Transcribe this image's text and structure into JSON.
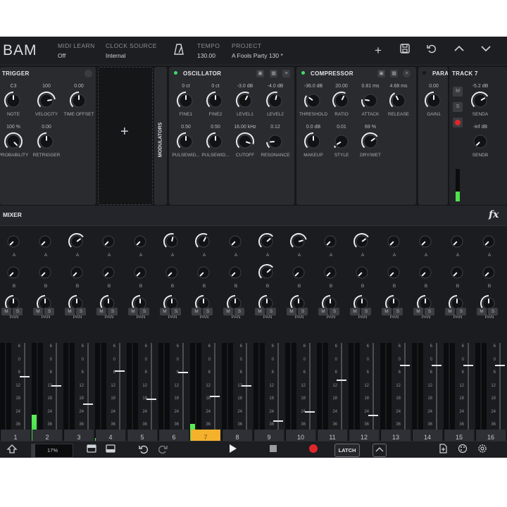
{
  "topbar": {
    "logo": "BAM",
    "midi_learn": {
      "caption": "MIDI LEARN",
      "value": "Off"
    },
    "clock_source": {
      "caption": "CLOCK SOURCE",
      "value": "Internal"
    },
    "tempo": {
      "caption": "TEMPO",
      "value": "130.00"
    },
    "project": {
      "caption": "PROJECT",
      "value": "A Fools Party 130 *"
    },
    "icons": [
      "metronome-icon",
      "add-icon",
      "save-icon",
      "undo-icon",
      "chevron-up-icon",
      "chevron-down-icon"
    ]
  },
  "trigger": {
    "title": "TRIGGER",
    "knobs": [
      {
        "value": "C3",
        "label": "NOTE"
      },
      {
        "value": "100",
        "label": "VELOCITY"
      },
      {
        "value": "0.00",
        "label": "TIME OFFSET"
      },
      {
        "value": "100 %",
        "label": "PROBABILITY"
      },
      {
        "value": "0.00",
        "label": "RETRIGGER"
      }
    ]
  },
  "modulators": {
    "label": "MODULATORS",
    "add": "+"
  },
  "oscillator": {
    "title": "OSCILLATOR",
    "knobs": [
      {
        "value": "0 ct",
        "label": "FINE1"
      },
      {
        "value": "0 ct",
        "label": "FINE2"
      },
      {
        "value": "-3.0 dB",
        "label": "LEVEL1"
      },
      {
        "value": "-4.0 dB",
        "label": "LEVEL2"
      },
      {
        "value": "0.50",
        "label": "PULSEWID..."
      },
      {
        "value": "0.50",
        "label": "PULSEWID..."
      },
      {
        "value": "16.00 kHz",
        "label": "CUTOFF"
      },
      {
        "value": "0.12",
        "label": "RESONANCE"
      }
    ]
  },
  "compressor": {
    "title": "COMPRESSOR",
    "knobs": [
      {
        "value": "-36.0 dB",
        "label": "THRESHOLD"
      },
      {
        "value": "20.00",
        "label": "RATIO"
      },
      {
        "value": "0.81 ms",
        "label": "ATTACK"
      },
      {
        "value": "4.68 ms",
        "label": "RELEASE"
      },
      {
        "value": "0.0 dB",
        "label": "MAKEUP"
      },
      {
        "value": "0.01",
        "label": "STYLE"
      },
      {
        "value": "69 %",
        "label": "DRY/WET"
      }
    ]
  },
  "para": {
    "title": "PARA",
    "knob": {
      "value": "0.00",
      "label": "GAIN1"
    }
  },
  "track7": {
    "title": "TRACK 7",
    "buttons": [
      "M",
      "S"
    ],
    "knobs": [
      {
        "value": "-5.2 dB",
        "label": "SENDA"
      },
      {
        "value": "-inf dB",
        "label": "SENDB"
      }
    ]
  },
  "mixer": {
    "title": "MIXER",
    "fx_label": "fx",
    "row_labels": [
      "A",
      "B",
      "PAN"
    ],
    "mute_label": "M",
    "solo_label": "S",
    "scale": [
      "6",
      "0",
      "6",
      "12",
      "18",
      "24",
      "36",
      "48",
      "60"
    ],
    "tracks": [
      {
        "num": "1",
        "a": 0.0,
        "b": 0.0,
        "pan": 0.5,
        "fader": 0.7,
        "meter": 0.0
      },
      {
        "num": "2",
        "a": 0.0,
        "b": 0.0,
        "pan": 0.5,
        "fader": 0.62,
        "meter": 0.35
      },
      {
        "num": "3",
        "a": 0.7,
        "b": 0.0,
        "pan": 0.5,
        "fader": 0.45,
        "meter": 0.0
      },
      {
        "num": "4",
        "a": 0.0,
        "b": 0.0,
        "pan": 0.5,
        "fader": 0.75,
        "meter": 0.14
      },
      {
        "num": "5",
        "a": 0.0,
        "b": 0.0,
        "pan": 0.5,
        "fader": 0.5,
        "meter": 0.0
      },
      {
        "num": "6",
        "a": 0.55,
        "b": 0.0,
        "pan": 0.5,
        "fader": 0.74,
        "meter": 0.1
      },
      {
        "num": "7",
        "a": 0.6,
        "b": 0.0,
        "pan": 0.5,
        "fader": 0.52,
        "meter": 0.27
      },
      {
        "num": "8",
        "a": 0.0,
        "b": 0.0,
        "pan": 0.5,
        "fader": 0.62,
        "meter": 0.0
      },
      {
        "num": "9",
        "a": 0.68,
        "b": 0.68,
        "pan": 0.5,
        "fader": 0.3,
        "meter": 0.0
      },
      {
        "num": "10",
        "a": 0.78,
        "b": 0.0,
        "pan": 0.5,
        "fader": 0.38,
        "meter": 0.0
      },
      {
        "num": "11",
        "a": 0.0,
        "b": 0.0,
        "pan": 0.5,
        "fader": 0.67,
        "meter": 0.0
      },
      {
        "num": "12",
        "a": 0.7,
        "b": 0.0,
        "pan": 0.5,
        "fader": 0.35,
        "meter": 0.0
      },
      {
        "num": "13",
        "a": 0.0,
        "b": 0.0,
        "pan": 0.5,
        "fader": 0.8,
        "meter": 0.0
      },
      {
        "num": "14",
        "a": 0.0,
        "b": 0.0,
        "pan": 0.5,
        "fader": 0.8,
        "meter": 0.0
      },
      {
        "num": "15",
        "a": 0.0,
        "b": 0.0,
        "pan": 0.5,
        "fader": 0.8,
        "meter": 0.0
      },
      {
        "num": "16",
        "a": 0.0,
        "b": 0.0,
        "pan": 0.5,
        "fader": 0.8,
        "meter": 0.0
      }
    ],
    "selected_track": "7"
  },
  "bottombar": {
    "cpu": "17%",
    "latch": "LATCH",
    "icons": [
      "keyboard-toggle-icon",
      "view-grid-icon",
      "view-mixer-icon",
      "undo-icon",
      "redo-icon",
      "play-icon",
      "stop-icon",
      "record-icon",
      "automation-icon",
      "file-icon",
      "palette-icon",
      "settings-icon"
    ]
  },
  "colors": {
    "accent": "#f5b12b",
    "led": "#3ddc6a",
    "meter": "#4fe34c",
    "record": "#e0262c"
  }
}
